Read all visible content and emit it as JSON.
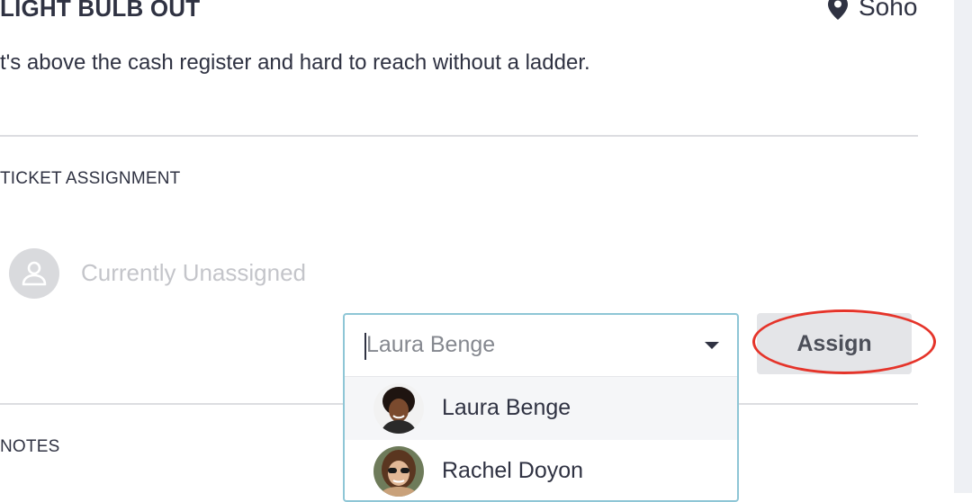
{
  "ticket": {
    "title": "LIGHT BULB OUT",
    "location": "Soho",
    "location_icon": "map-pin-icon",
    "description": "t's above the cash register and hard to reach without a ladder."
  },
  "assignment": {
    "section_label": "TICKET ASSIGNMENT",
    "current_status": "Currently Unassigned",
    "select_value": "Laura Benge",
    "options": [
      {
        "label": "Laura Benge"
      },
      {
        "label": "Rachel Doyon"
      }
    ],
    "assign_label": "Assign"
  },
  "notes": {
    "section_label": "NOTES"
  },
  "colors": {
    "annotation_circle": "#e5342a",
    "dropdown_border": "#8ec6d6"
  }
}
